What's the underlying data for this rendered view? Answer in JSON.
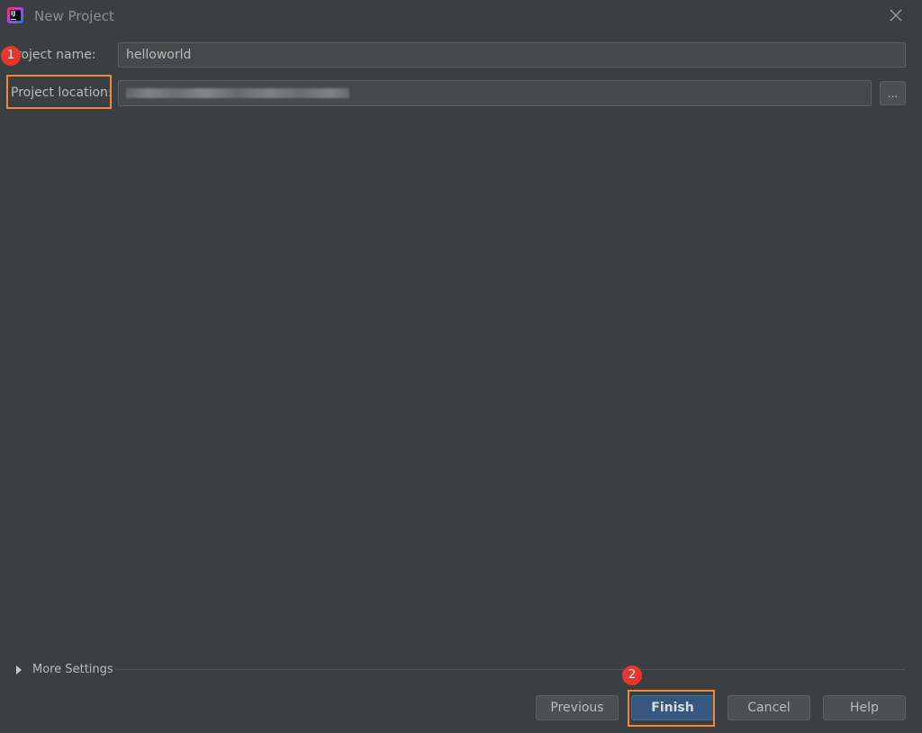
{
  "window": {
    "title": "New Project",
    "app_icon": "intellij-idea-icon",
    "app_icon_letters": "IJ",
    "close_icon": "close-icon"
  },
  "form": {
    "project_name_label": "roject name:",
    "project_name_value": "helloworld",
    "project_location_label": "Project location:",
    "project_location_value": "",
    "browse_label": "..."
  },
  "more_settings": {
    "label": "More Settings",
    "icon": "expand-triangle-icon"
  },
  "buttons": {
    "previous": "Previous",
    "finish": "Finish",
    "cancel": "Cancel",
    "help": "Help"
  },
  "annotations": {
    "step1": "1",
    "step2": "2",
    "highlight_color": "#f0883a",
    "badge_color": "#e8362f"
  },
  "theme": {
    "background": "#3c3f41",
    "field_background": "#45494a",
    "primary_button": "#365880"
  }
}
